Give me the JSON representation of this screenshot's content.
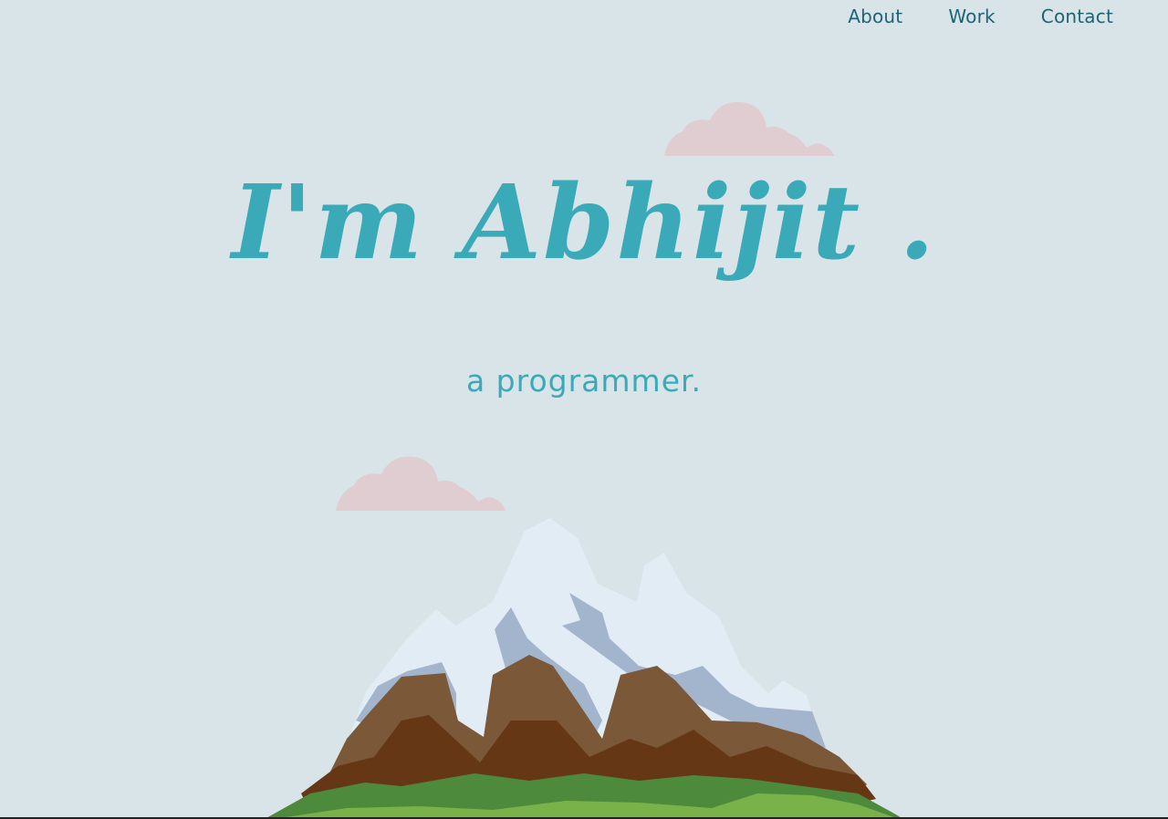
{
  "nav": {
    "items": [
      {
        "label": "About"
      },
      {
        "label": "Work"
      },
      {
        "label": "Contact"
      }
    ]
  },
  "hero": {
    "title": "I'm Abhijit .",
    "subtitle": "a programmer."
  },
  "colors": {
    "background": "#d8e4e7",
    "accent": "#3aaab9",
    "nav_text": "#1f6475",
    "cloud": "#e0cdd2"
  }
}
